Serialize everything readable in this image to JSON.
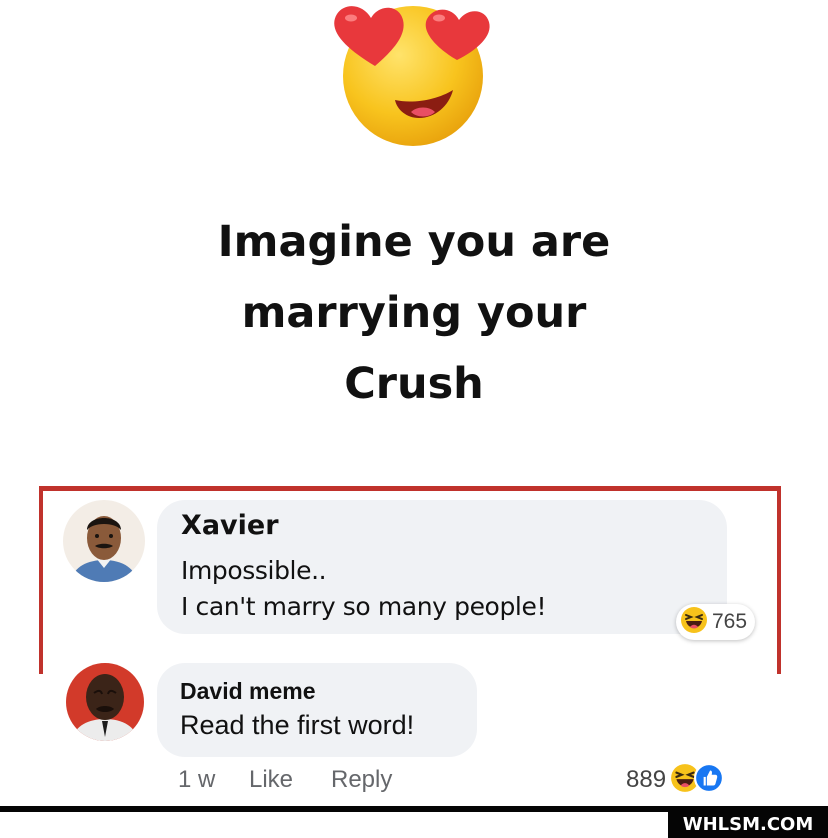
{
  "post": {
    "emoji": "heart-eyes-emoji",
    "headline_lines": [
      "Imagine you are",
      "marrying your",
      "Crush"
    ]
  },
  "comments": [
    {
      "author": "Xavier",
      "lines": [
        "Impossible..",
        "I can't marry so many people!"
      ],
      "reaction_icon": "haha-reaction-icon",
      "reaction_count": "765"
    },
    {
      "author": "David meme",
      "text": "Read the first word!",
      "time": "1 w",
      "like_label": "Like",
      "reply_label": "Reply",
      "reaction_icons": [
        "haha-reaction-icon",
        "like-reaction-icon"
      ],
      "reaction_count": "889"
    }
  ],
  "watermark": "WHLSM.COM",
  "colors": {
    "highlight_frame": "#c0322c",
    "bubble": "#f0f2f5",
    "like_blue": "#1877f2",
    "emoji_yellow": "#f7c21b",
    "heart_red": "#e8383c"
  }
}
